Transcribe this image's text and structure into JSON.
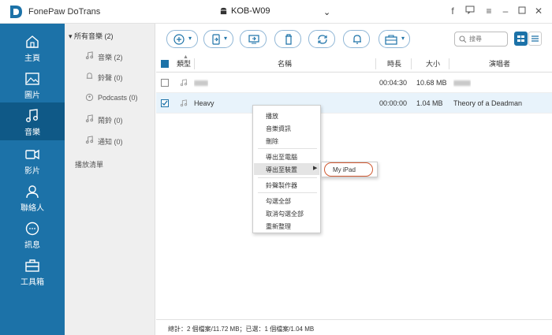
{
  "app": {
    "title": "FonePaw DoTrans"
  },
  "device": {
    "name": "KOB-W09"
  },
  "window_icons": [
    "facebook-icon",
    "feedback-icon",
    "menu-icon",
    "minimize-icon",
    "maximize-icon",
    "close-icon"
  ],
  "sidebar": {
    "items": [
      {
        "label": "主頁",
        "icon": "home-icon"
      },
      {
        "label": "圖片",
        "icon": "photo-icon"
      },
      {
        "label": "音樂",
        "icon": "music-icon"
      },
      {
        "label": "影片",
        "icon": "video-icon"
      },
      {
        "label": "聯絡人",
        "icon": "contacts-icon"
      },
      {
        "label": "訊息",
        "icon": "message-icon"
      },
      {
        "label": "工具箱",
        "icon": "toolbox-icon"
      }
    ],
    "active_index": 2
  },
  "categories": {
    "header": "所有音樂 (2)",
    "items": [
      {
        "label": "音樂 (2)",
        "icon": "note-icon"
      },
      {
        "label": "鈴聲 (0)",
        "icon": "bell-icon"
      },
      {
        "label": "Podcasts (0)",
        "icon": "podcast-icon"
      },
      {
        "label": "鬧鈴 (0)",
        "icon": "note-icon"
      },
      {
        "label": "通知 (0)",
        "icon": "note-icon"
      }
    ],
    "playlist_label": "播放清單"
  },
  "toolbar": {
    "buttons": [
      "add-icon",
      "export-to-device-icon",
      "export-to-pc-icon",
      "delete-icon",
      "sync-icon",
      "ringtone-icon",
      "toolbox-icon"
    ],
    "search_placeholder": "搜尋"
  },
  "table": {
    "columns": {
      "type": "類型",
      "name": "名稱",
      "duration": "時長",
      "size": "大小",
      "artist": "演唱者"
    },
    "rows": [
      {
        "name": "",
        "duration": "00:04:30",
        "size": "10.68 MB",
        "artist": "",
        "checked": false,
        "selected": false
      },
      {
        "name": "Heavy",
        "duration": "00:00:00",
        "size": "1.04 MB",
        "artist": "Theory of a Deadman",
        "checked": true,
        "selected": true
      }
    ]
  },
  "context_menu": {
    "items": [
      "播放",
      "音樂資訊",
      "刪除",
      "導出至電腦",
      "導出至裝置",
      "鈴聲製作器",
      "勾選全部",
      "取消勾選全部",
      "重新整理"
    ],
    "highlighted": "導出至裝置",
    "submenu": [
      "My iPad"
    ]
  },
  "status": {
    "text": "總計：2 個檔案/11.72 MB；已選：1 個檔案/1.04 MB"
  },
  "colors": {
    "sidebar": "#1c72a8",
    "sidebar_active": "#0f5987",
    "accent": "#1c72a8",
    "highlight_ring": "#d05a33"
  }
}
